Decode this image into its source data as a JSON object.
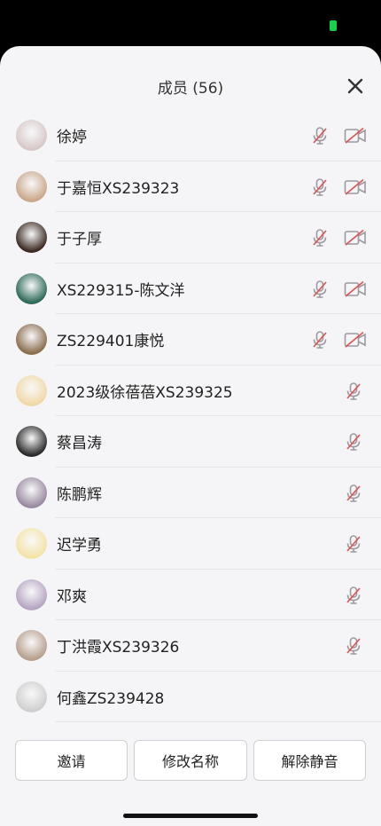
{
  "title": "成员 (56)",
  "members": [
    {
      "name": "徐婷",
      "camera": true,
      "color": "#d8c8c8"
    },
    {
      "name": "于嘉恒XS239323",
      "camera": true,
      "color": "#caa88c"
    },
    {
      "name": "于子厚",
      "camera": true,
      "color": "#3b2a22"
    },
    {
      "name": "XS229315-陈文洋",
      "camera": true,
      "color": "#2e6a58"
    },
    {
      "name": "ZS229401康悦",
      "camera": true,
      "color": "#8a6e4e"
    },
    {
      "name": "2023级徐蓓蓓XS239325",
      "camera": false,
      "color": "#f0d9a8"
    },
    {
      "name": "蔡昌涛",
      "camera": false,
      "color": "#2a2a2a"
    },
    {
      "name": "陈鹏辉",
      "camera": false,
      "color": "#9a8aa0"
    },
    {
      "name": "迟学勇",
      "camera": false,
      "color": "#f3e4a6"
    },
    {
      "name": "邓爽",
      "camera": false,
      "color": "#b6a6c2"
    },
    {
      "name": "丁洪霞XS239326",
      "camera": false,
      "color": "#b7a08e"
    },
    {
      "name": "何鑫ZS239428",
      "camera": false,
      "color": "#cfcfcf"
    }
  ],
  "footer": {
    "invite_label": "邀请",
    "rename_label": "修改名称",
    "unmute_label": "解除静音"
  },
  "icons": {
    "close": "close-icon",
    "mic_muted": "mic-muted-icon",
    "camera_off": "camera-off-icon"
  }
}
